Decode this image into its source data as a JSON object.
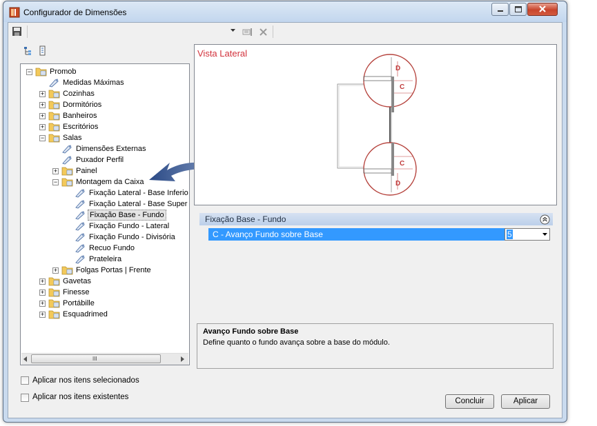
{
  "window": {
    "title": "Configurador de Dimensões"
  },
  "tree": {
    "items": [
      {
        "label": "Promob"
      },
      {
        "label": "Medidas Máximas"
      },
      {
        "label": "Cozinhas"
      },
      {
        "label": "Dormitórios"
      },
      {
        "label": "Banheiros"
      },
      {
        "label": "Escritórios"
      },
      {
        "label": "Salas"
      },
      {
        "label": "Dimensões Externas"
      },
      {
        "label": "Puxador Perfil"
      },
      {
        "label": "Painel"
      },
      {
        "label": "Montagem da Caixa"
      },
      {
        "label": "Fixação Lateral - Base Inferio"
      },
      {
        "label": "Fixação Lateral - Base Super"
      },
      {
        "label": "Fixação Base - Fundo"
      },
      {
        "label": "Fixação Fundo - Lateral"
      },
      {
        "label": "Fixação Fundo - Divisória"
      },
      {
        "label": "Recuo Fundo"
      },
      {
        "label": "Prateleira"
      },
      {
        "label": "Folgas Portas | Frente"
      },
      {
        "label": "Gavetas"
      },
      {
        "label": "Finesse"
      },
      {
        "label": "Portábille"
      },
      {
        "label": "Esquadrimed"
      }
    ]
  },
  "preview": {
    "title": "Vista Lateral",
    "label_d": "D",
    "label_c": "C"
  },
  "properties": {
    "category": "Fixação Base - Fundo",
    "row_label": "C - Avanço Fundo sobre Base",
    "row_value": "5"
  },
  "description": {
    "title": "Avanço Fundo sobre Base",
    "text": "Define quanto o fundo avança sobre a base do módulo."
  },
  "options": {
    "apply_selected": "Aplicar nos itens selecionados",
    "apply_existing": "Aplicar nos itens existentes"
  },
  "buttons": {
    "conclude": "Concluir",
    "apply": "Aplicar"
  },
  "scrollbar": {
    "thumb_grip": "III"
  }
}
